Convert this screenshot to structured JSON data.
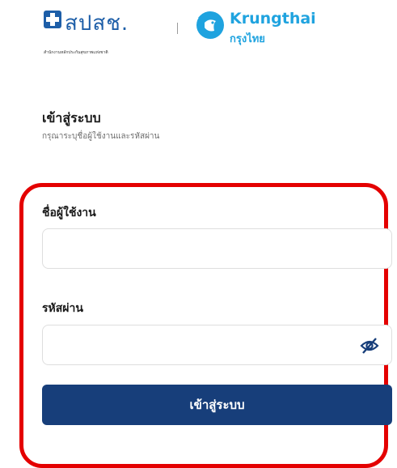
{
  "logos": {
    "nhso": {
      "text": "สปสช.",
      "subtitle": "สำนักงานหลักประกันสุขภาพแห่งชาติ",
      "icon": "nhso-cross-icon"
    },
    "krungthai": {
      "name": "Krungthai",
      "name_thai": "กรุงไทย",
      "icon": "krungthai-bird-icon"
    },
    "brand_colors": {
      "nhso_blue": "#1d5ea8",
      "krungthai_blue": "#1fa3df"
    }
  },
  "login": {
    "title": "เข้าสู่ระบบ",
    "subtitle": "กรุณาระบุชื่อผู้ใช้งานและรหัสผ่าน",
    "username_label": "ชื่อผู้ใช้งาน",
    "username_value": "",
    "password_label": "รหัสผ่าน",
    "password_value": "",
    "password_toggle_icon": "eye-slash-icon",
    "submit_label": "เข้าสู่ระบบ"
  },
  "colors": {
    "button": "#173e7a",
    "highlight": "#e40000"
  }
}
